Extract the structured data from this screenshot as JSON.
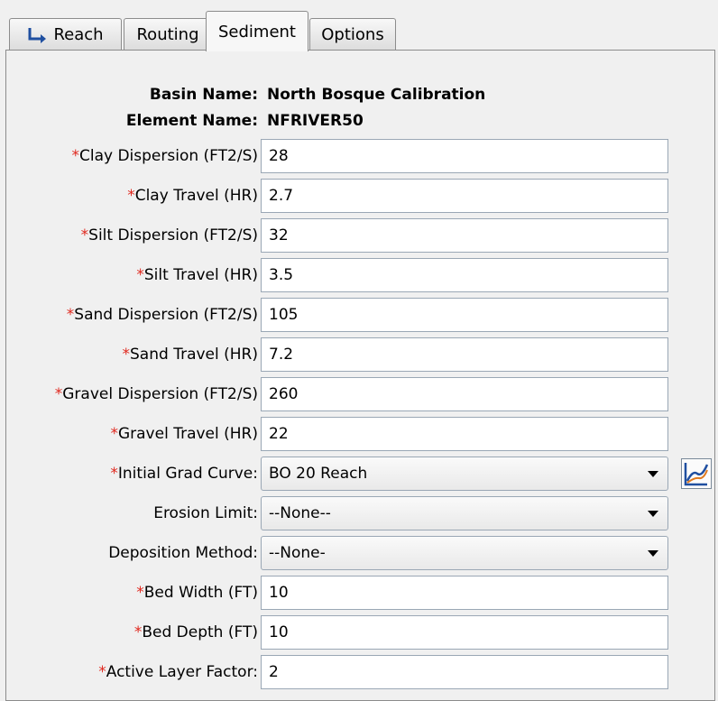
{
  "tabs": [
    {
      "label": "Reach",
      "icon": "reach-arrow-icon"
    },
    {
      "label": "Routing"
    },
    {
      "label": "Sediment",
      "active": true
    },
    {
      "label": "Options"
    }
  ],
  "info": {
    "basin_label": "Basin Name:",
    "basin_value": "North Bosque Calibration",
    "element_label": "Element Name:",
    "element_value": "NFRIVER50"
  },
  "required_marker": "*",
  "fields": {
    "clay_dispersion": {
      "label": "Clay Dispersion (FT2/S)",
      "value": "28"
    },
    "clay_travel": {
      "label": "Clay Travel (HR)",
      "value": "2.7"
    },
    "silt_dispersion": {
      "label": "Silt Dispersion (FT2/S)",
      "value": "32"
    },
    "silt_travel": {
      "label": "Silt Travel (HR)",
      "value": "3.5"
    },
    "sand_dispersion": {
      "label": "Sand Dispersion (FT2/S)",
      "value": "105"
    },
    "sand_travel": {
      "label": "Sand Travel (HR)",
      "value": "7.2"
    },
    "gravel_dispersion": {
      "label": "Gravel Dispersion (FT2/S)",
      "value": "260"
    },
    "gravel_travel": {
      "label": "Gravel Travel (HR)",
      "value": "22"
    },
    "initial_grad_curve": {
      "label": "Initial Grad Curve:",
      "value": "BO 20 Reach",
      "icon": "curve-chart-icon"
    },
    "erosion_limit": {
      "label": "Erosion Limit:",
      "value": "--None--"
    },
    "deposition_method": {
      "label": "Deposition Method:",
      "value": "--None-"
    },
    "bed_width": {
      "label": "Bed Width (FT)",
      "value": "10"
    },
    "bed_depth": {
      "label": "Bed Depth (FT)",
      "value": "10"
    },
    "active_layer_factor": {
      "label": "Active Layer Factor:",
      "value": "2"
    }
  },
  "colors": {
    "required": "#e0281e",
    "curve_blue": "#1f4fa0",
    "curve_orange": "#e07a1e"
  }
}
